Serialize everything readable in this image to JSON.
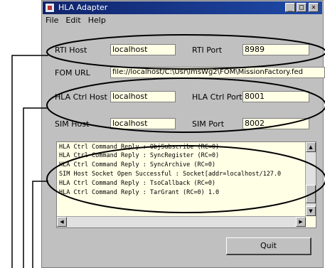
{
  "window": {
    "title": "HLA Adapter",
    "minimize": "_",
    "maximize": "□",
    "close": "✕"
  },
  "menu": [
    "File",
    "Edit",
    "Help"
  ],
  "rti": {
    "host_label": "RTI Host",
    "host_value": "localhost",
    "port_label": "RTI Port",
    "port_value": "8989"
  },
  "fom": {
    "label": "FOM URL",
    "value": "file://localhost/C:\\Usr\\lmsWg2\\FOM\\MissionFactory.fed"
  },
  "hla_ctrl": {
    "host_label": "HLA Ctrl Host",
    "host_value": "localhost",
    "port_label": "HLA Ctrl Port",
    "port_value": "8001"
  },
  "sim": {
    "host_label": "SIM Host",
    "host_value": "localhost",
    "port_label": "SIM Port",
    "port_value": "8002"
  },
  "log": [
    "HLA Ctrl Command Reply : ObjSubscribe (RC=0)",
    "HLA Ctrl Command Reply : SyncRegister (RC=0)",
    "HLA Ctrl Command Reply : SyncArchive (RC=0)",
    "SIM Host Socket Open Successful : Socket[addr=localhost/127.0",
    "HLA Ctrl Command Reply : TsoCallback (RC=0)",
    "HLA Ctrl Command Reply : TarGrant (RC=0) 1.0"
  ],
  "quit_label": "Quit"
}
